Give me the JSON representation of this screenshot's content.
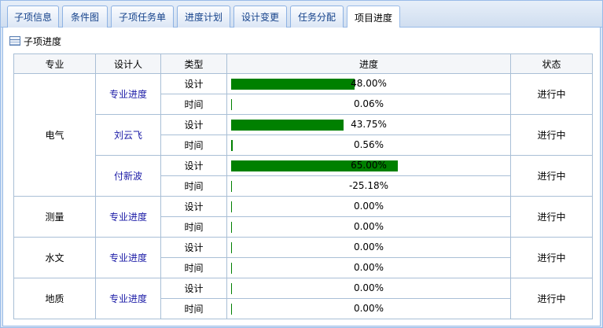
{
  "tabs": [
    {
      "label": "子项信息",
      "active": false
    },
    {
      "label": "条件图",
      "active": false
    },
    {
      "label": "子项任务单",
      "active": false
    },
    {
      "label": "进度计划",
      "active": false
    },
    {
      "label": "设计变更",
      "active": false
    },
    {
      "label": "任务分配",
      "active": false
    },
    {
      "label": "项目进度",
      "active": true
    }
  ],
  "panel": {
    "title": "子项进度",
    "icon": "grid-icon"
  },
  "table": {
    "headers": {
      "discipline": "专业",
      "designer": "设计人",
      "type": "类型",
      "progress": "进度",
      "status": "状态"
    },
    "groups": [
      {
        "discipline": "电气",
        "designers": [
          {
            "name": "专业进度",
            "status": "进行中",
            "rows": [
              {
                "type": "设计",
                "text": "48.00%",
                "value": 48.0
              },
              {
                "type": "时间",
                "text": "0.06%",
                "value": 0.06
              }
            ]
          },
          {
            "name": "刘云飞",
            "status": "进行中",
            "rows": [
              {
                "type": "设计",
                "text": "43.75%",
                "value": 43.75
              },
              {
                "type": "时间",
                "text": "0.56%",
                "value": 0.56
              }
            ]
          },
          {
            "name": "付新波",
            "status": "进行中",
            "rows": [
              {
                "type": "设计",
                "text": "65.00%",
                "value": 65.0
              },
              {
                "type": "时间",
                "text": "-25.18%",
                "value": -25.18
              }
            ]
          }
        ]
      },
      {
        "discipline": "测量",
        "designers": [
          {
            "name": "专业进度",
            "status": "进行中",
            "rows": [
              {
                "type": "设计",
                "text": "0.00%",
                "value": 0
              },
              {
                "type": "时间",
                "text": "0.00%",
                "value": 0
              }
            ]
          }
        ]
      },
      {
        "discipline": "水文",
        "designers": [
          {
            "name": "专业进度",
            "status": "进行中",
            "rows": [
              {
                "type": "设计",
                "text": "0.00%",
                "value": 0
              },
              {
                "type": "时间",
                "text": "0.00%",
                "value": 0
              }
            ]
          }
        ]
      },
      {
        "discipline": "地质",
        "designers": [
          {
            "name": "专业进度",
            "status": "进行中",
            "rows": [
              {
                "type": "设计",
                "text": "0.00%",
                "value": 0
              },
              {
                "type": "时间",
                "text": "0.00%",
                "value": 0
              }
            ]
          }
        ]
      }
    ]
  },
  "colors": {
    "bar": "#008000",
    "link": "#1a1aa6",
    "border": "#99bbe8"
  }
}
